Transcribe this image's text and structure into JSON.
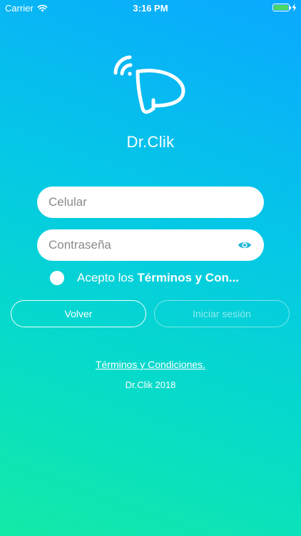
{
  "status_bar": {
    "carrier": "Carrier",
    "time": "3:16 PM"
  },
  "brand": {
    "name": "Dr.Clik"
  },
  "form": {
    "phone_placeholder": "Celular",
    "password_placeholder": "Contraseña",
    "terms_prefix": "Acepto los",
    "terms_bold": "Términos y Con..."
  },
  "buttons": {
    "back_label": "Volver",
    "login_label": "Iniciar sesión"
  },
  "footer": {
    "terms_link": "Términos y Condiciones.",
    "copyright": "Dr.Clik 2018"
  },
  "colors": {
    "gradient_top": "#0aa8ff",
    "gradient_bottom": "#14eaa6",
    "eye_icon": "#1fb8d8",
    "battery": "#4cd964"
  }
}
